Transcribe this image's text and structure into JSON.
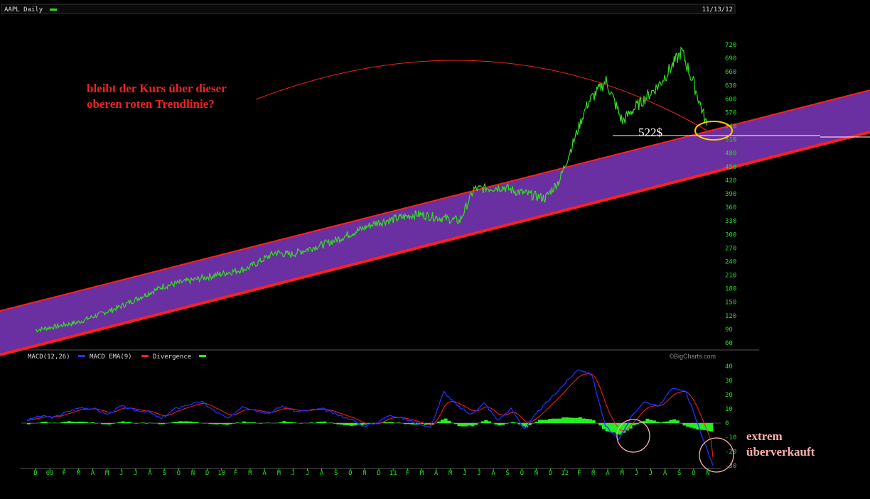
{
  "header": {
    "symbol_label": "AAPL Daily",
    "date_label": "11/13/12"
  },
  "annotations": {
    "question_line1": "bleibt der Kurs über dieser",
    "question_line2": "oberen roten Trendlinie?",
    "level_label": "522$",
    "oversold_line1": "extrem",
    "oversold_line2": "überverkauft"
  },
  "colors": {
    "price": "#33dd22",
    "channel_fill": "#6a2fa0",
    "trendline": "#ff2020",
    "macd": "#2030ff",
    "signal": "#ff2020",
    "divergence": "#22ee22",
    "axis_text": "#22dd22",
    "annotation_red": "#ee2222",
    "annotation_pink": "#ffb0b0",
    "circle_yellow": "#ffcc00"
  },
  "chart_data": [
    {
      "type": "line",
      "name": "price",
      "x": [
        "2008-12-01",
        "2009-03-01",
        "2009-06-01",
        "2009-09-01",
        "2009-12-01",
        "2010-03-01",
        "2010-05-01",
        "2010-06-01",
        "2010-09-01",
        "2010-12-01",
        "2011-03-01",
        "2011-06-01",
        "2011-07-01",
        "2011-09-01",
        "2011-10-01",
        "2011-12-01",
        "2012-01-01",
        "2012-03-01",
        "2012-04-10",
        "2012-05-15",
        "2012-06-01",
        "2012-08-01",
        "2012-09-20",
        "2012-10-20",
        "2012-11-13"
      ],
      "y": [
        88,
        105,
        140,
        185,
        205,
        225,
        260,
        255,
        285,
        325,
        345,
        330,
        400,
        405,
        395,
        380,
        420,
        590,
        640,
        550,
        570,
        630,
        705,
        620,
        540
      ],
      "yticks": [
        720,
        690,
        660,
        630,
        600,
        570,
        540,
        510,
        480,
        450,
        420,
        390,
        360,
        330,
        300,
        270,
        240,
        210,
        180,
        150,
        120,
        90,
        60
      ],
      "xticks": [
        "D",
        "09",
        "F",
        "M",
        "A",
        "M",
        "J",
        "J",
        "A",
        "S",
        "O",
        "N",
        "D",
        "10",
        "F",
        "M",
        "A",
        "M",
        "J",
        "J",
        "A",
        "S",
        "O",
        "N",
        "D",
        "11",
        "F",
        "M",
        "A",
        "M",
        "J",
        "J",
        "A",
        "S",
        "O",
        "N",
        "D",
        "12",
        "F",
        "M",
        "A",
        "M",
        "J",
        "J",
        "A",
        "S",
        "O",
        "N"
      ],
      "level": 522
    },
    {
      "type": "line",
      "name": "macd",
      "legend": [
        "MACD(12,26)",
        "MACD EMA(9)",
        "Divergence"
      ],
      "watermark": "©BigCharts.com",
      "yticks": [
        40,
        30,
        20,
        10,
        0,
        -10,
        -20,
        -30
      ],
      "macd": [
        2,
        5,
        4,
        8,
        11,
        10,
        6,
        12,
        9,
        8,
        3,
        10,
        13,
        15,
        8,
        3,
        12,
        9,
        7,
        12,
        8,
        9,
        10,
        6,
        3,
        -2,
        0,
        6,
        3,
        0,
        -3,
        22,
        12,
        6,
        14,
        2,
        10,
        -4,
        8,
        18,
        28,
        38,
        34,
        -2,
        -12,
        6,
        15,
        12,
        25,
        22,
        -4,
        -30
      ],
      "divergence": [
        -1,
        1,
        0,
        1,
        1,
        0,
        -1,
        1,
        0,
        0,
        -1,
        1,
        1,
        0,
        -1,
        -1,
        1,
        0,
        0,
        1,
        0,
        0,
        1,
        -1,
        -2,
        -1,
        0,
        1,
        -1,
        -1,
        -1,
        3,
        -2,
        -2,
        2,
        -2,
        1,
        -3,
        2,
        3,
        4,
        4,
        2,
        -6,
        -8,
        -2,
        3,
        0,
        3,
        -3,
        -5,
        -6
      ]
    }
  ]
}
